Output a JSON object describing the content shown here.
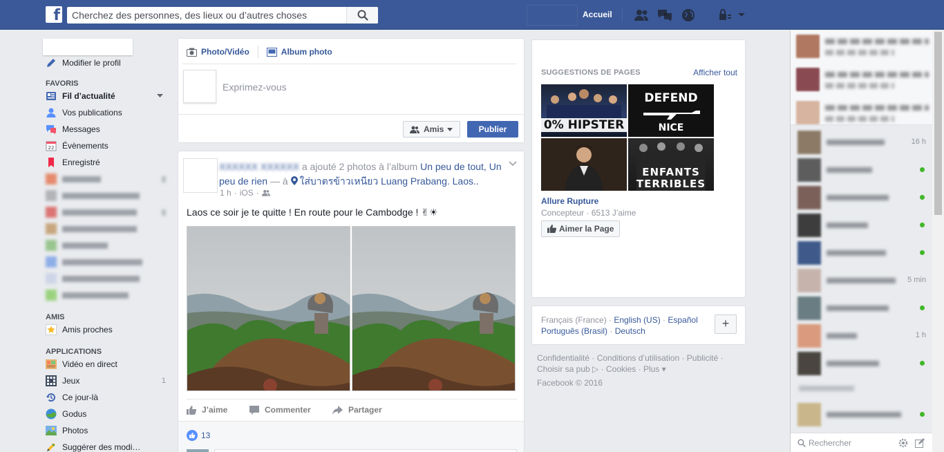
{
  "topbar": {
    "logo": "f",
    "search_placeholder": "Cherchez des personnes, des lieux ou d’autres choses",
    "home_label": "Accueil"
  },
  "left": {
    "edit_profile": "Modifier le profil",
    "favoris_heading": "FAVORIS",
    "favoris": [
      {
        "label": "Fil d’actualité",
        "icon": "news-feed-icon"
      },
      {
        "label": "Vos publications",
        "icon": "user-icon"
      },
      {
        "label": "Messages",
        "icon": "messages-icon"
      },
      {
        "label": "Évènements",
        "icon": "calendar-icon"
      },
      {
        "label": "Enregistré",
        "icon": "bookmark-icon"
      }
    ],
    "calendar_day": "22",
    "amis_heading": "AMIS",
    "amis": [
      {
        "label": "Amis proches",
        "icon": "star-icon"
      }
    ],
    "applications_heading": "APPLICATIONS",
    "applications": [
      {
        "label": "Vidéo en direct",
        "icon": "live-video-icon",
        "count": ""
      },
      {
        "label": "Jeux",
        "icon": "games-icon",
        "count": "1"
      },
      {
        "label": "Ce jour-là",
        "icon": "on-this-day-icon",
        "count": ""
      },
      {
        "label": "Godus",
        "icon": "godus-icon",
        "count": ""
      },
      {
        "label": "Photos",
        "icon": "photos-icon",
        "count": ""
      },
      {
        "label": "Suggérer des modi…",
        "icon": "pencil-icon",
        "count": ""
      }
    ]
  },
  "composer": {
    "tab_photo": "Photo/Vidéo",
    "tab_album": "Album photo",
    "placeholder": "Exprimez-vous",
    "audience": "Amis",
    "publish": "Publier"
  },
  "post": {
    "action_text": " a ajouté 2 photos à l’album ",
    "album": "Un peu de tout, Un peu de rien",
    "at_text": " — à ",
    "place": "ใส่บาตรข้าวเหนียว Luang Prabang. Laos..",
    "time": "1 h",
    "via": "iOS",
    "text": "Laos ce soir je te quitte ! En route pour le Cambodge ! ✌☀",
    "like": "J’aime",
    "comment": "Commenter",
    "share": "Partager",
    "like_count": "13"
  },
  "suggestions": {
    "title": "SUGGESTIONS DE PAGES",
    "see_all": "Afficher tout",
    "tile1_text": "0% HIPSTER",
    "tile2_text_top": "DEFEND",
    "tile2_text_bottom": "NICE",
    "tile3_text": "",
    "tile4_text_top": "ENFANTS",
    "tile4_text_bottom": "TERRIBLES",
    "page_name": "Allure Rupture",
    "page_meta": "Concepteur · 6513 J’aime",
    "like_page": "Aimer la Page"
  },
  "languages": {
    "current": "Français (France)",
    "options": [
      "English (US)",
      "Español",
      "Português (Brasil)",
      "Deutsch"
    ],
    "plus": "+"
  },
  "footer": {
    "links": "Confidentialité · Conditions d’utilisation · Publicité · Choisir sa pub ▷ · Cookies · Plus ▾",
    "copyright": "Facebook © 2016"
  },
  "chat": {
    "times": [
      "16 h",
      "5 min",
      "1 h"
    ],
    "search_placeholder": "Rechercher"
  },
  "colors": {
    "brand": "#3b5998",
    "link": "#365899",
    "button": "#4267b2",
    "online": "#42b72a"
  }
}
